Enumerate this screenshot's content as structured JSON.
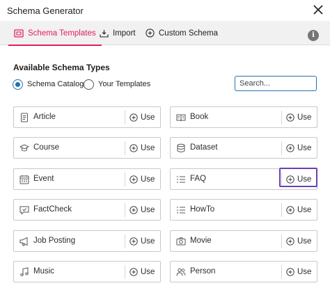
{
  "dialog": {
    "title": "Schema Generator"
  },
  "tabs": [
    {
      "label": "Schema Templates",
      "icon": "template-icon",
      "active": true
    },
    {
      "label": "Import",
      "icon": "import-icon",
      "active": false
    },
    {
      "label": "Custom Schema",
      "icon": "plus-circle-icon",
      "active": false
    }
  ],
  "section": {
    "title": "Available Schema Types"
  },
  "radios": [
    {
      "label": "Schema Catalog",
      "checked": true
    },
    {
      "label": "Your Templates",
      "checked": false
    }
  ],
  "search": {
    "placeholder": "Search..."
  },
  "use_label": "Use",
  "schemas": [
    {
      "label": "Article",
      "icon": "document-icon"
    },
    {
      "label": "Book",
      "icon": "book-icon"
    },
    {
      "label": "Course",
      "icon": "graduation-cap-icon"
    },
    {
      "label": "Dataset",
      "icon": "database-icon"
    },
    {
      "label": "Event",
      "icon": "calendar-icon"
    },
    {
      "label": "FAQ",
      "icon": "list-icon"
    },
    {
      "label": "FactCheck",
      "icon": "chat-check-icon"
    },
    {
      "label": "HowTo",
      "icon": "list-icon"
    },
    {
      "label": "Job Posting",
      "icon": "megaphone-icon"
    },
    {
      "label": "Movie",
      "icon": "camera-icon"
    },
    {
      "label": "Music",
      "icon": "music-note-icon"
    },
    {
      "label": "Person",
      "icon": "people-icon"
    }
  ],
  "colors": {
    "accent": "#e41c5b",
    "primary": "#2271b1",
    "highlight": "#6a3fb5"
  }
}
